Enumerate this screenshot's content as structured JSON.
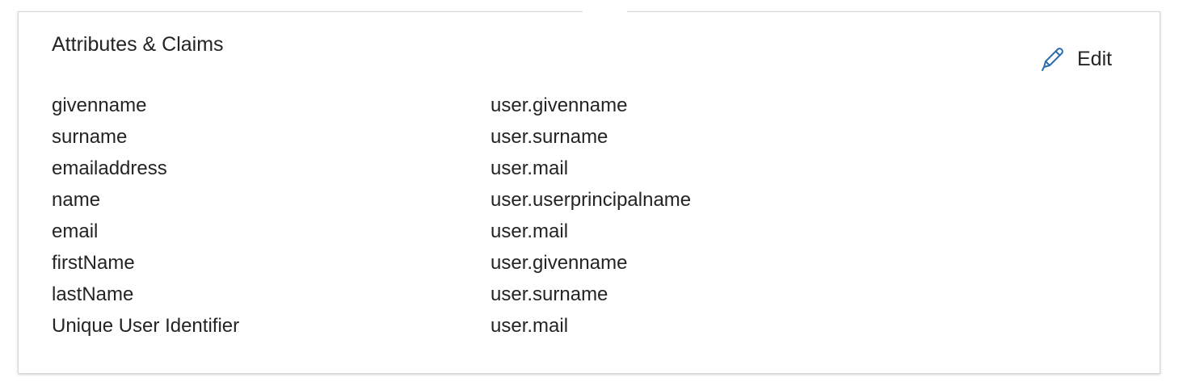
{
  "card": {
    "title": "Attributes & Claims",
    "edit_label": "Edit",
    "edit_icon": "pencil-icon",
    "accent_color": "#2b6cb0"
  },
  "claims": [
    {
      "name": "givenname",
      "value": "user.givenname"
    },
    {
      "name": "surname",
      "value": "user.surname"
    },
    {
      "name": "emailaddress",
      "value": "user.mail"
    },
    {
      "name": "name",
      "value": "user.userprincipalname"
    },
    {
      "name": "email",
      "value": "user.mail"
    },
    {
      "name": "firstName",
      "value": "user.givenname"
    },
    {
      "name": "lastName",
      "value": "user.surname"
    },
    {
      "name": "Unique User Identifier",
      "value": "user.mail"
    }
  ]
}
